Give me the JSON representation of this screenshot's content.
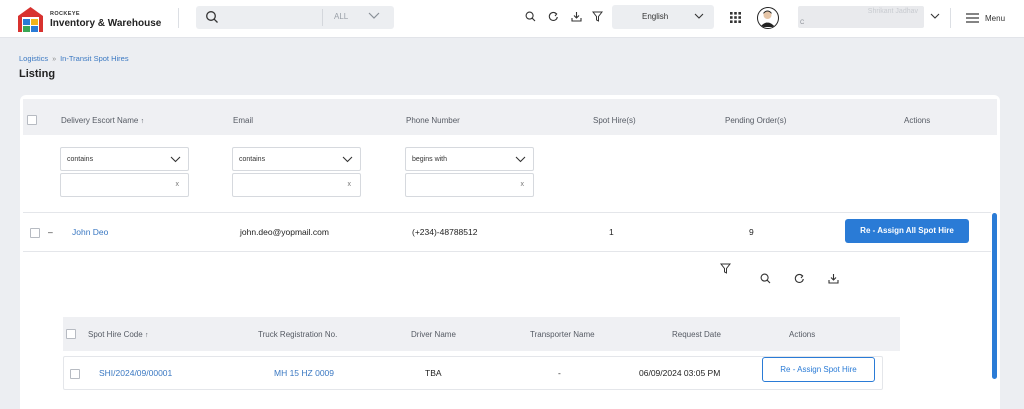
{
  "header": {
    "brand_small": "ROCKEYE",
    "brand_name": "Inventory & Warehouse",
    "search_scope": "ALL",
    "language": "English",
    "user_name": "Shrikant Jadhav",
    "user_role": "C",
    "menu_label": "Menu",
    "icons": [
      "search-icon",
      "refresh-icon",
      "download-icon",
      "filter-icon",
      "apps-grid-icon",
      "hamburger-icon"
    ]
  },
  "breadcrumb": {
    "items": [
      "Logistics",
      "In-Transit Spot Hires"
    ]
  },
  "page_title": "Listing",
  "table": {
    "columns": [
      "Delivery Escort Name",
      "Email",
      "Phone Number",
      "Spot Hire(s)",
      "Pending Order(s)",
      "Actions"
    ],
    "filters": {
      "name_operator": "contains",
      "email_operator": "contains",
      "phone_operator": "begins with",
      "clear_glyph": "x"
    },
    "rows": [
      {
        "expand_glyph": "–",
        "name": "John Deo",
        "email": "john.deo@yopmail.com",
        "phone": "(+234)-48788512",
        "spot_hires": "1",
        "pending_orders": "9",
        "action": "Re - Assign All Spot Hire"
      }
    ]
  },
  "subtable": {
    "columns": [
      "Spot Hire Code",
      "Truck Registration No.",
      "Driver Name",
      "Transporter Name",
      "Request Date",
      "Actions"
    ],
    "rows": [
      {
        "code": "SHI/2024/09/00001",
        "truck": "MH 15 HZ 0009",
        "driver": "TBA",
        "transporter": "-",
        "request_date": "06/09/2024 03:05 PM",
        "action": "Re - Assign Spot Hire"
      }
    ]
  },
  "colors": {
    "primary": "#2a7bd6",
    "link": "#3a78c2",
    "background": "#eceef2"
  }
}
